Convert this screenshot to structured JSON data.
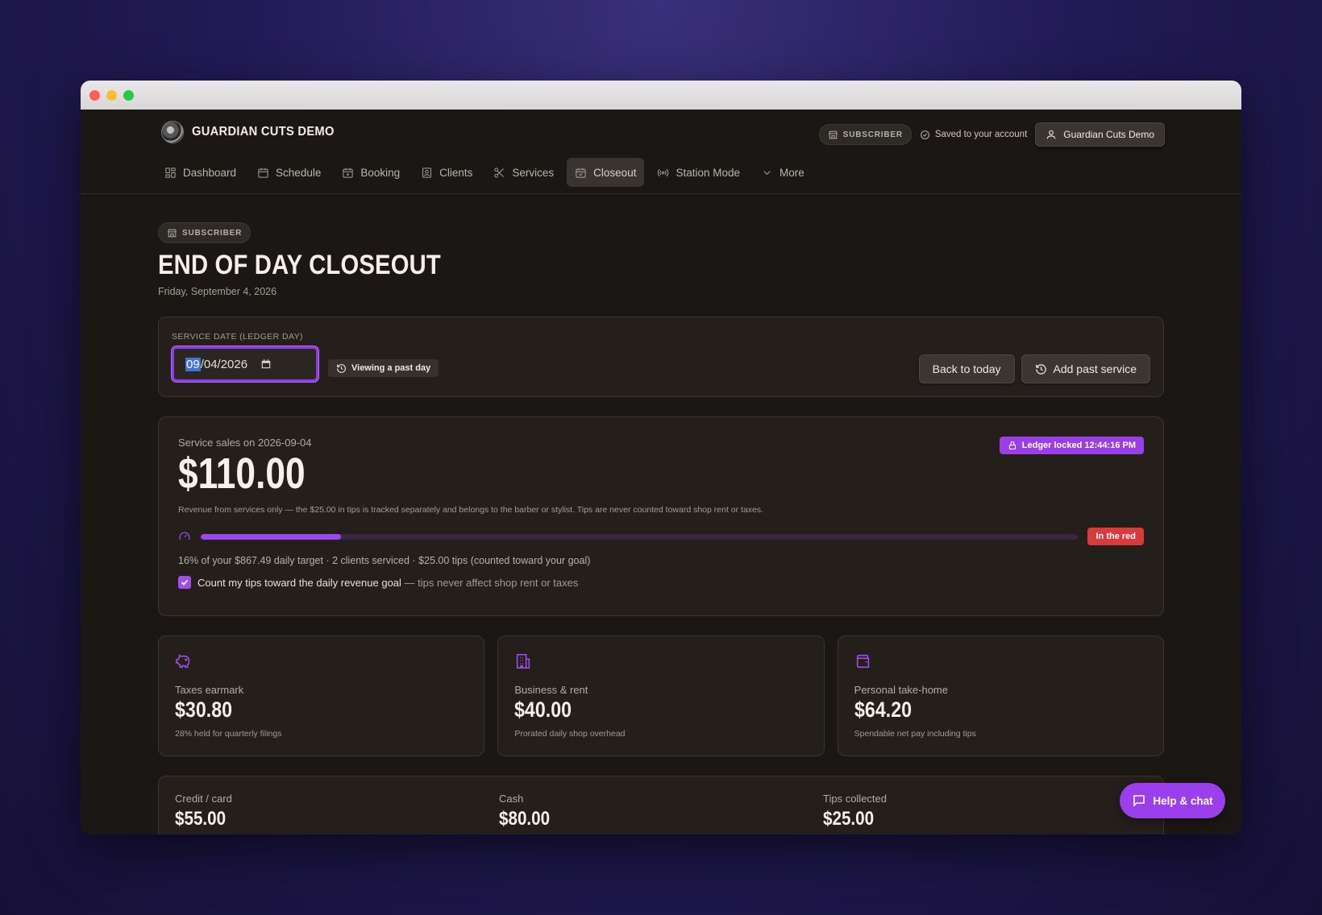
{
  "brand": {
    "name": "GUARDIAN CUTS DEMO"
  },
  "top": {
    "subscriber_badge": "SUBSCRIBER",
    "saved_text": "Saved to your account",
    "user_name": "Guardian Cuts Demo"
  },
  "nav": [
    {
      "label": "Dashboard",
      "icon": "dashboard-icon"
    },
    {
      "label": "Schedule",
      "icon": "calendar-icon"
    },
    {
      "label": "Booking",
      "icon": "calendar-plus-icon"
    },
    {
      "label": "Clients",
      "icon": "contact-icon"
    },
    {
      "label": "Services",
      "icon": "scissors-icon"
    },
    {
      "label": "Closeout",
      "icon": "calendar-check-icon",
      "active": true
    },
    {
      "label": "Station Mode",
      "icon": "radio-icon"
    },
    {
      "label": "More",
      "icon": "chevron-down-icon"
    }
  ],
  "page": {
    "badge": "SUBSCRIBER",
    "title": "END OF DAY CLOSEOUT",
    "date": "Friday, September 4, 2026"
  },
  "service_date": {
    "label": "SERVICE DATE (LEDGER DAY)",
    "month": "09",
    "rest": "/04/2026",
    "viewing_badge": "Viewing a past day",
    "back_button": "Back to today",
    "add_button": "Add past service"
  },
  "sales": {
    "label": "Service sales on 2026-09-04",
    "amount": "$110.00",
    "locked_badge": "Ledger locked 12:44:16 PM",
    "note": "Revenue from services only — the $25.00 in tips is tracked separately and belongs to the barber or stylist. Tips are never counted toward shop rent or taxes.",
    "progress_fraction": 0.16,
    "status_badge": "In the red",
    "progress_text": "16% of your $867.49 daily target · 2 clients serviced · $25.00 tips (counted toward your goal)",
    "checkbox_label": "Count my tips toward the daily revenue goal",
    "checkbox_muted": " — tips never affect shop rent or taxes",
    "checkbox_checked": true
  },
  "tiles": [
    {
      "icon": "piggy-bank-icon",
      "label": "Taxes earmark",
      "value": "$30.80",
      "sub": "28% held for quarterly filings"
    },
    {
      "icon": "building-icon",
      "label": "Business & rent",
      "value": "$40.00",
      "sub": "Prorated daily shop overhead"
    },
    {
      "icon": "wallet-icon",
      "label": "Personal take-home",
      "value": "$64.20",
      "sub": "Spendable net pay including tips"
    }
  ],
  "payments": [
    {
      "label": "Credit / card",
      "value": "$55.00"
    },
    {
      "label": "Cash",
      "value": "$80.00"
    },
    {
      "label": "Tips collected",
      "value": "$25.00"
    }
  ],
  "help": {
    "label": "Help & chat"
  },
  "colors": {
    "accent": "#9b3fec",
    "danger": "#d93a3a",
    "background": "#1b1714"
  }
}
